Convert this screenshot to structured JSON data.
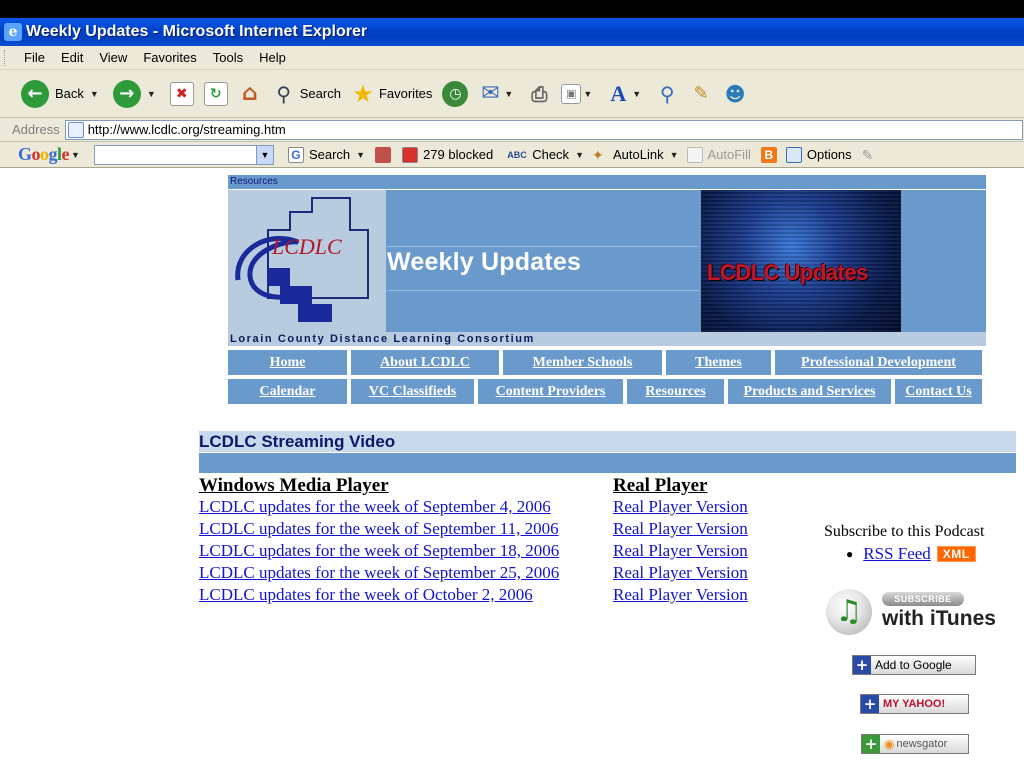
{
  "window": {
    "title": "Weekly Updates - Microsoft Internet Explorer"
  },
  "menu": [
    "File",
    "Edit",
    "View",
    "Favorites",
    "Tools",
    "Help"
  ],
  "toolbar": {
    "back": "Back",
    "search": "Search",
    "favorites": "Favorites"
  },
  "address": {
    "label": "Address",
    "url": "http://www.lcdlc.org/streaming.htm"
  },
  "googlebar": {
    "logo": "Google",
    "search": "Search",
    "blocked": "279 blocked",
    "check": "Check",
    "autolink": "AutoLink",
    "autofill": "AutoFill",
    "options": "Options"
  },
  "page": {
    "resources_label": "Resources",
    "banner_title": "Weekly Updates",
    "banner_photo_text": "LCDLC Updates",
    "consortium": "Lorain County Distance Learning Consortium",
    "logo_text": "LCDLC",
    "nav_row1": [
      "Home",
      "About LCDLC",
      "Member Schools",
      "Themes",
      "Professional Development"
    ],
    "nav_row2": [
      "Calendar",
      "VC Classifieds",
      "Content Providers",
      "Resources",
      "Products and Services",
      "Contact Us"
    ],
    "section_title": "LCDLC Streaming Video",
    "wmp_heading": "Windows Media Player",
    "real_heading": "Real Player",
    "wmp_links": [
      "LCDLC updates for the week of September 4, 2006",
      "LCDLC updates for the week of September 11, 2006",
      "LCDLC updates for the week of September 18, 2006",
      "LCDLC updates for the week of September 25, 2006",
      "LCDLC updates for the week of October 2, 2006"
    ],
    "real_links": [
      "Real Player Version",
      "Real Player Version",
      "Real Player Version",
      "Real Player Version",
      "Real Player Version"
    ],
    "subscribe": "Subscribe to this Podcast",
    "rss_feed": "RSS Feed",
    "xml_badge": "XML",
    "itunes_subscribe": "SUBSCRIBE",
    "itunes_with": "with iTunes",
    "add_to_google": "Add to Google",
    "my_yahoo": "MY YAHOO!",
    "newsgator": "newsgator"
  }
}
